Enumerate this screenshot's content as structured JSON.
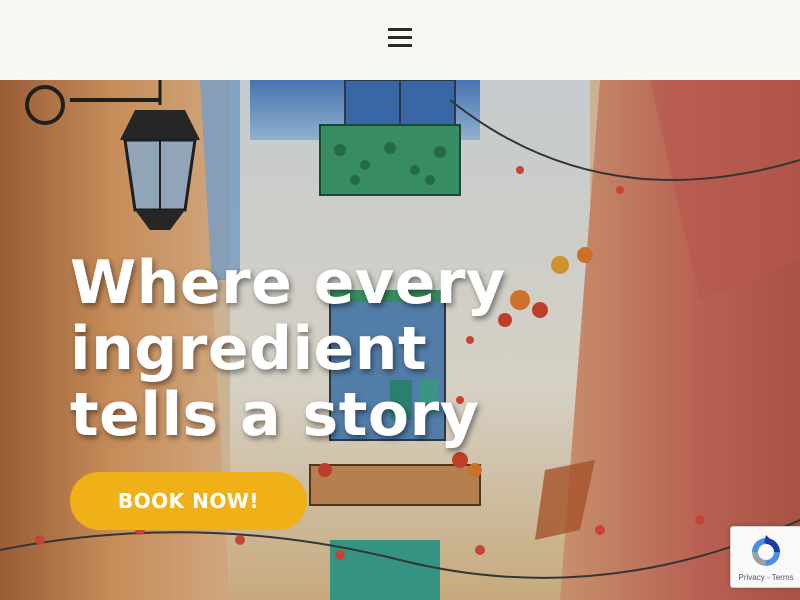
{
  "header": {
    "menu_icon": "hamburger-menu-icon",
    "background": "#faf8f3"
  },
  "hero": {
    "background_description": "watercolor-street-painting",
    "title": "Where every ingredient tells a story",
    "book_button_label": "BOOK NOW!",
    "button_color": "#f0b118",
    "title_color": "#ffffff"
  },
  "recaptcha": {
    "icon": "recaptcha-icon",
    "privacy_label": "Privacy",
    "separator": " - ",
    "terms_label": "Terms"
  }
}
